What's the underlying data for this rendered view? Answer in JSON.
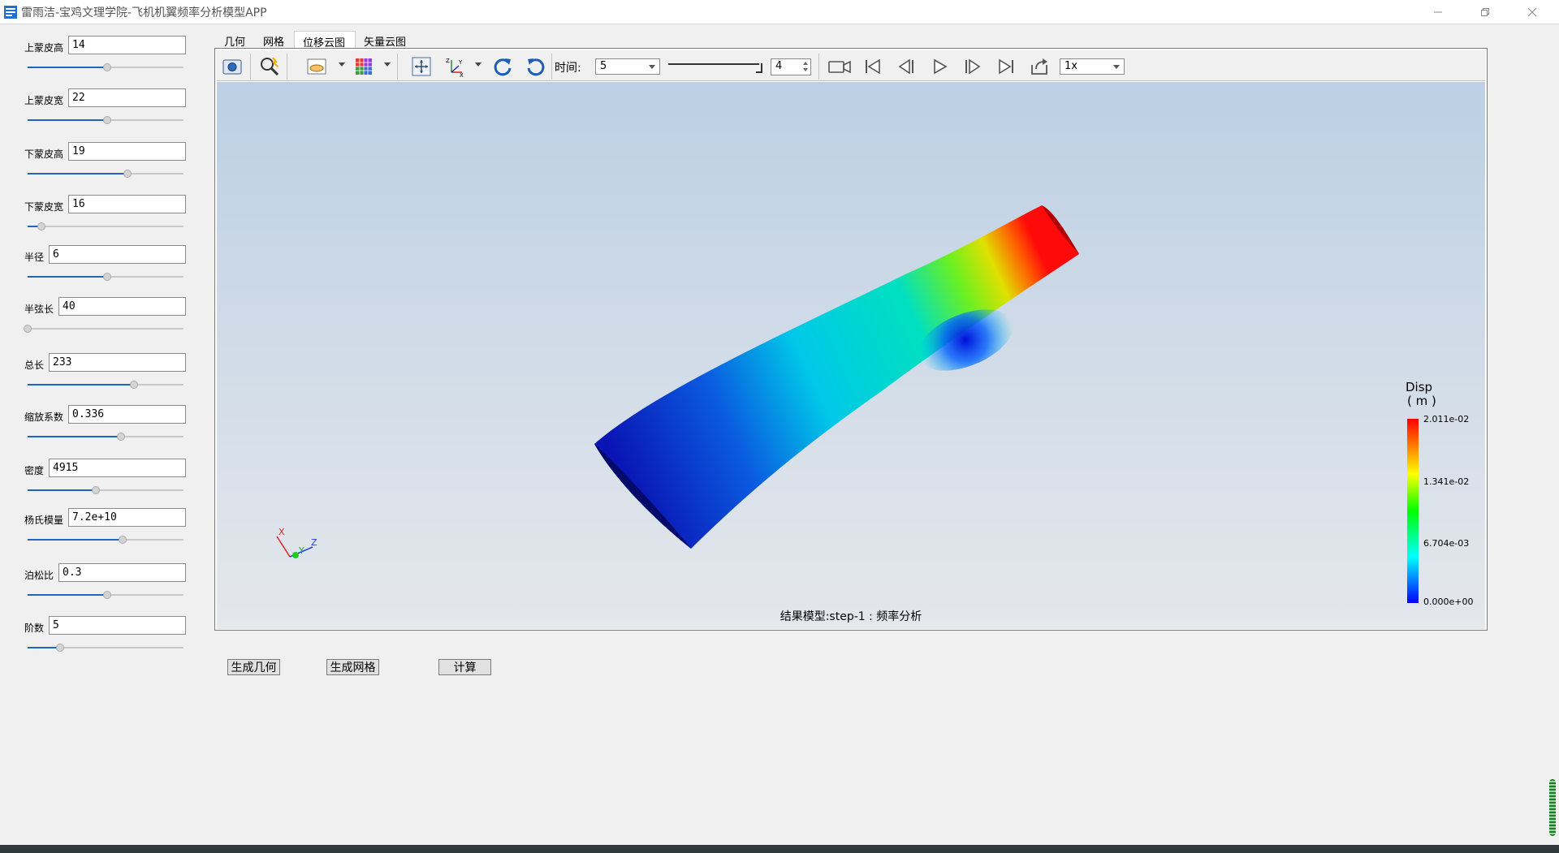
{
  "window": {
    "title": "雷雨洁-宝鸡文理学院-飞机机翼频率分析模型APP"
  },
  "params": [
    {
      "label": "上蒙皮高",
      "value": "14",
      "slider": 0.51
    },
    {
      "label": "上蒙皮宽",
      "value": "22",
      "slider": 0.51
    },
    {
      "label": "下蒙皮高",
      "value": "19",
      "slider": 0.64
    },
    {
      "label": "下蒙皮宽",
      "value": "16",
      "slider": 0.09
    },
    {
      "label": "半径",
      "value": "6",
      "slider": 0.51
    },
    {
      "label": "半弦长",
      "value": "40",
      "slider": 0.0
    },
    {
      "label": "总长",
      "value": "233",
      "slider": 0.68
    },
    {
      "label": "缩放系数",
      "value": "0.336",
      "slider": 0.6
    },
    {
      "label": "密度",
      "value": "4915",
      "slider": 0.44
    },
    {
      "label": "杨氏模量",
      "value": "7.2e+10",
      "slider": 0.61
    },
    {
      "label": "泊松比",
      "value": "0.3",
      "slider": 0.51
    },
    {
      "label": "阶数",
      "value": "5",
      "slider": 0.21
    }
  ],
  "tabs": [
    {
      "label": "几何",
      "active": false
    },
    {
      "label": "网格",
      "active": false
    },
    {
      "label": "位移云图",
      "active": true
    },
    {
      "label": "矢量云图",
      "active": false
    }
  ],
  "toolbar": {
    "time_label": "时间:",
    "time_value": "5",
    "frame_value": "4",
    "speed_value": "1x",
    "icons": [
      "camera-icon",
      "zoom-icon",
      "surface-mode-icon",
      "color-cube-icon",
      "fit-view-icon",
      "axes-icon",
      "rotate-cw-icon",
      "rotate-ccw-icon",
      "record-icon",
      "first-frame-icon",
      "prev-frame-icon",
      "play-icon",
      "next-frame-icon",
      "last-frame-icon",
      "export-icon"
    ]
  },
  "viewport": {
    "caption": "结果模型:step-1 : 频率分析",
    "axes": {
      "x": "X",
      "y": "Y",
      "z": "Z"
    },
    "legend": {
      "title": "Disp",
      "unit": "( m )",
      "ticks": [
        "2.011e-02",
        "1.341e-02",
        "6.704e-03",
        "0.000e+00"
      ],
      "colors": [
        "#ff0000",
        "#ffff00",
        "#00ff00",
        "#00ffff",
        "#0000ff"
      ]
    }
  },
  "actions": {
    "gen_geometry": "生成几何",
    "gen_mesh": "生成网格",
    "compute": "计算"
  }
}
